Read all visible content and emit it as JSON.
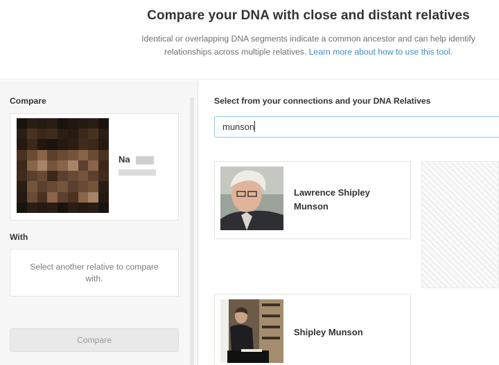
{
  "header": {
    "title": "Compare your DNA with close and distant relatives",
    "subtitle_line1": "Identical or overlapping DNA segments indicate a common ancestor and can help identify",
    "subtitle_line2": "relationships across multiple relatives.",
    "learn_more": "Learn more about how to use this tool."
  },
  "left_panel": {
    "compare_label": "Compare",
    "compare_person_name": "Na",
    "with_label": "With",
    "with_placeholder": "Select another relative to compare with.",
    "compare_button": "Compare"
  },
  "right_panel": {
    "select_label": "Select from your connections and your DNA Relatives",
    "search_value": "munson",
    "results": [
      {
        "name_line1": "Lawrence Shipley",
        "name_line2": "Munson"
      },
      {
        "name_line1": "Shipley Munson",
        "name_line2": ""
      }
    ]
  },
  "colors": {
    "link": "#3e8ec6",
    "input_focus_border": "#8fc8e7",
    "panel_background": "#f7f7f7"
  }
}
